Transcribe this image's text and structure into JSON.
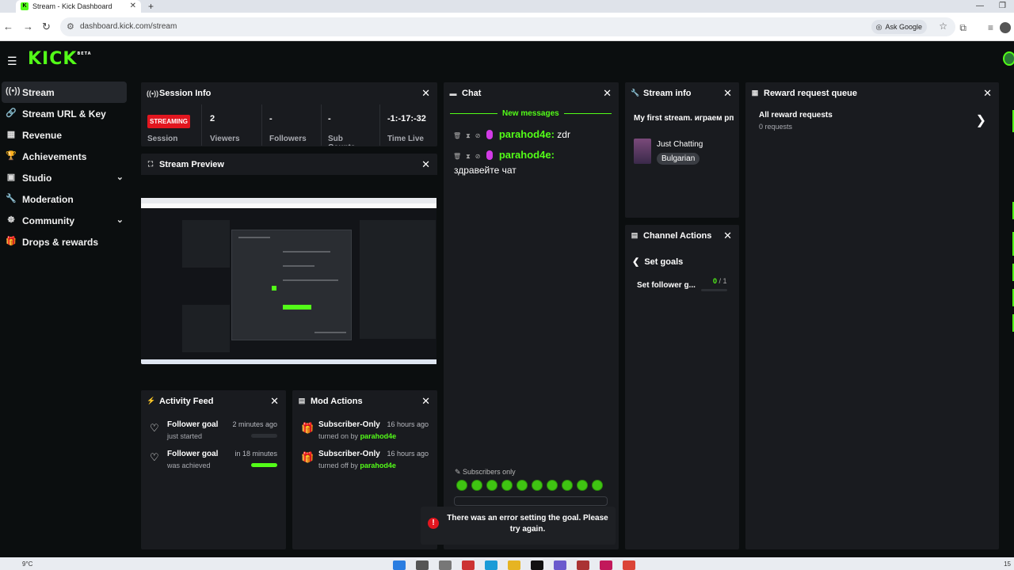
{
  "browser": {
    "tab_title": "Stream - Kick Dashboard",
    "url": "dashboard.kick.com/stream",
    "ask_google": "Ask Google"
  },
  "app": {
    "logo": "KICK",
    "logo_badge": "BETA"
  },
  "sidebar": {
    "items": [
      {
        "label": "Stream",
        "icon": "broadcast-icon"
      },
      {
        "label": "Stream URL & Key",
        "icon": "link-icon"
      },
      {
        "label": "Revenue",
        "icon": "revenue-icon"
      },
      {
        "label": "Achievements",
        "icon": "trophy-icon"
      },
      {
        "label": "Studio",
        "icon": "studio-icon"
      },
      {
        "label": "Moderation",
        "icon": "wrench-icon"
      },
      {
        "label": "Community",
        "icon": "community-icon"
      },
      {
        "label": "Drops & rewards",
        "icon": "gift-icon"
      }
    ]
  },
  "session_info": {
    "title": "Session Info",
    "status": "STREAMING",
    "session_label": "Session",
    "viewers_value": "2",
    "viewers_label": "Viewers",
    "followers_value": "-",
    "followers_label": "Followers",
    "subs_value": "-",
    "subs_label": "Sub Counts",
    "time_value": "-1:-17:-32",
    "time_label": "Time Live"
  },
  "stream_preview": {
    "title": "Stream Preview"
  },
  "chat": {
    "title": "Chat",
    "new_messages": "New messages",
    "messages": [
      {
        "user": "parahod4e",
        "text": "zdr"
      },
      {
        "user": "parahod4e",
        "text": "здравейте чат"
      }
    ],
    "subscribers_only": "Subscribers only"
  },
  "stream_info": {
    "title": "Stream info",
    "stream_title": "My first stream. играем рп",
    "category": "Just Chatting",
    "language": "Bulgarian"
  },
  "channel_actions": {
    "title": "Channel Actions",
    "back_label": "Set goals",
    "goal_label": "Set follower g...",
    "goal_current": "0",
    "goal_total": "/ 1"
  },
  "reward_queue": {
    "title": "Reward request queue",
    "all_label": "All reward requests",
    "count": "0 requests"
  },
  "activity_feed": {
    "title": "Activity Feed",
    "items": [
      {
        "title": "Follower goal",
        "sub": "just started",
        "time": "2 minutes ago",
        "progress": 0
      },
      {
        "title": "Follower goal",
        "sub": "was achieved",
        "time": "in 18 minutes",
        "progress": 1
      }
    ]
  },
  "mod_actions": {
    "title": "Mod Actions",
    "items": [
      {
        "title": "Subscriber-Only",
        "sub_prefix": "turned on by",
        "user": "parahod4e",
        "time": "16 hours ago"
      },
      {
        "title": "Subscriber-Only",
        "sub_prefix": "turned off by",
        "user": "parahod4e",
        "time": "16 hours ago"
      }
    ]
  },
  "toast": {
    "message": "There was an error setting the goal. Please try again."
  },
  "taskbar": {
    "temperature": "9°C",
    "time": "15"
  },
  "colors": {
    "accent": "#53fc18",
    "error": "#e2161f",
    "panel": "#191b1f",
    "background": "#0b0e0f"
  }
}
